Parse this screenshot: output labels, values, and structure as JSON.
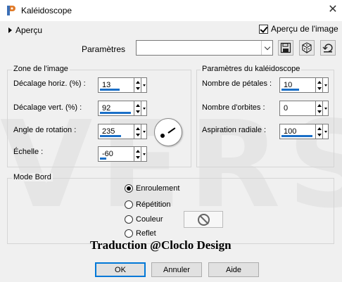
{
  "window": {
    "title": "Kaléidoscope",
    "close_glyph": "✕"
  },
  "watermark": "VERS",
  "preview": {
    "toggle_label": "Aperçu",
    "checkbox_label": "Aperçu de l'image",
    "checked": true
  },
  "presets": {
    "label": "Paramètres",
    "value": "",
    "icons": [
      "save-icon",
      "dice-icon",
      "reset-icon"
    ]
  },
  "image_zone": {
    "title": "Zone de l'image",
    "fields": [
      {
        "label": "Décalage horiz. (%) :",
        "value": "13",
        "level": 0.6
      },
      {
        "label": "Décalage vert. (%) :",
        "value": "92",
        "level": 0.95
      },
      {
        "label": "Angle de rotation :",
        "value": "235",
        "level": 0.65
      },
      {
        "label": "Échelle :",
        "value": "-60",
        "level": 0.2
      }
    ]
  },
  "kaleido": {
    "title": "Paramètres du kaléidoscope",
    "fields": [
      {
        "label": "Nombre de pétales :",
        "value": "10",
        "level": 0.55
      },
      {
        "label": "Nombre d'orbites :",
        "value": "0",
        "level": 0
      },
      {
        "label": "Aspiration radiale :",
        "value": "100",
        "level": 0.95
      }
    ]
  },
  "border_mode": {
    "title": "Mode Bord",
    "options": [
      {
        "label": "Enroulement",
        "selected": true
      },
      {
        "label": "Répétition",
        "selected": false
      },
      {
        "label": "Couleur",
        "selected": false
      },
      {
        "label": "Reflet",
        "selected": false
      }
    ]
  },
  "credit": "Traduction @Cloclo Design",
  "buttons": {
    "ok": "OK",
    "cancel": "Annuler",
    "help": "Aide"
  }
}
